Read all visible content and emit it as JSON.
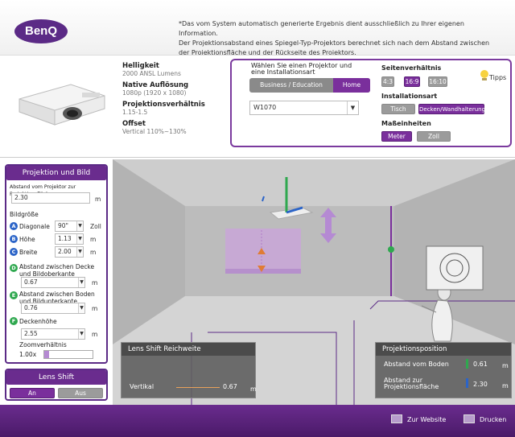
{
  "header": {
    "logo": "BenQ",
    "disclaimer_1": "*Das vom System automatisch generierte Ergebnis dient ausschließlich zu Ihrer eigenen Information.",
    "disclaimer_2": "Der Projektionsabstand eines Spiegel-Typ-Projektors berechnet sich nach dem Abstand zwischen der Projektionsfläche und der Rückseite des Projektors."
  },
  "specs": {
    "brightness_label": "Helligkeit",
    "brightness_value": "2000 ANSL Lumens",
    "resolution_label": "Native Auflösung",
    "resolution_value": "1080p (1920 x 1080)",
    "ratio_label": "Projektionsverhältnis",
    "ratio_value": "1.15-1.5",
    "offset_label": "Offset",
    "offset_value": "Vertical 110%~130%"
  },
  "selector": {
    "title": "Wählen Sie einen Projektor und eine Installationsart",
    "tab_business": "Business / Education",
    "tab_home": "Home",
    "model_value": "W1070",
    "aspect_label": "Seitenverhältnis",
    "aspect_options": [
      "4:3",
      "16:9",
      "16:10"
    ],
    "aspect_selected": "16:9",
    "install_label": "Installationsart",
    "install_options": [
      "Tisch",
      "Decken/Wandhalterung"
    ],
    "install_selected": "Decken/Wandhalterung",
    "units_label": "Maßeinheiten",
    "units_options": [
      "Meter",
      "Zoll"
    ],
    "units_selected": "Meter",
    "tips": "Tipps"
  },
  "panel": {
    "title": "Projektion und Bild",
    "distance_label": "Abstand vom Projektor zur Projektionsfläche",
    "distance_value": "2.30",
    "unit_m": "m",
    "image_size_label": "Bildgröße",
    "diag_label": "Diagonale",
    "diag_value": "90\"",
    "diag_unit": "Zoll",
    "height_label": "Höhe",
    "height_value": "1.13",
    "width_label": "Breite",
    "width_value": "2.00",
    "ceiling_label": "Abstand zwischen Decke und Bildoberkante",
    "ceiling_value": "0.67",
    "floor_label": "Abstand zwischen Boden und Bildunterkante",
    "floor_value": "0.76",
    "room_height_label": "Deckenhöhe",
    "room_height_value": "2.55",
    "zoom_label": "Zoomverhältnis",
    "zoom_value": "1.00x",
    "zoom_level": 0.05
  },
  "lens_shift": {
    "title": "Lens Shift",
    "on": "An",
    "off": "Aus",
    "range_title": "Lens Shift Reichweite",
    "vertical_label": "Vertikal",
    "vertical_value": "0.67",
    "unit": "m"
  },
  "position": {
    "title": "Projektionsposition",
    "floor_label": "Abstand vom Boden",
    "floor_value": "0.61",
    "screen_label": "Abstand zur Projektionsfläche",
    "screen_value": "2.30",
    "unit": "m"
  },
  "footer": {
    "website": "Zur Website",
    "print": "Drucken"
  },
  "colors": {
    "brand": "#6a2c8e",
    "green": "#2fa84f",
    "blue": "#2b64c8"
  }
}
